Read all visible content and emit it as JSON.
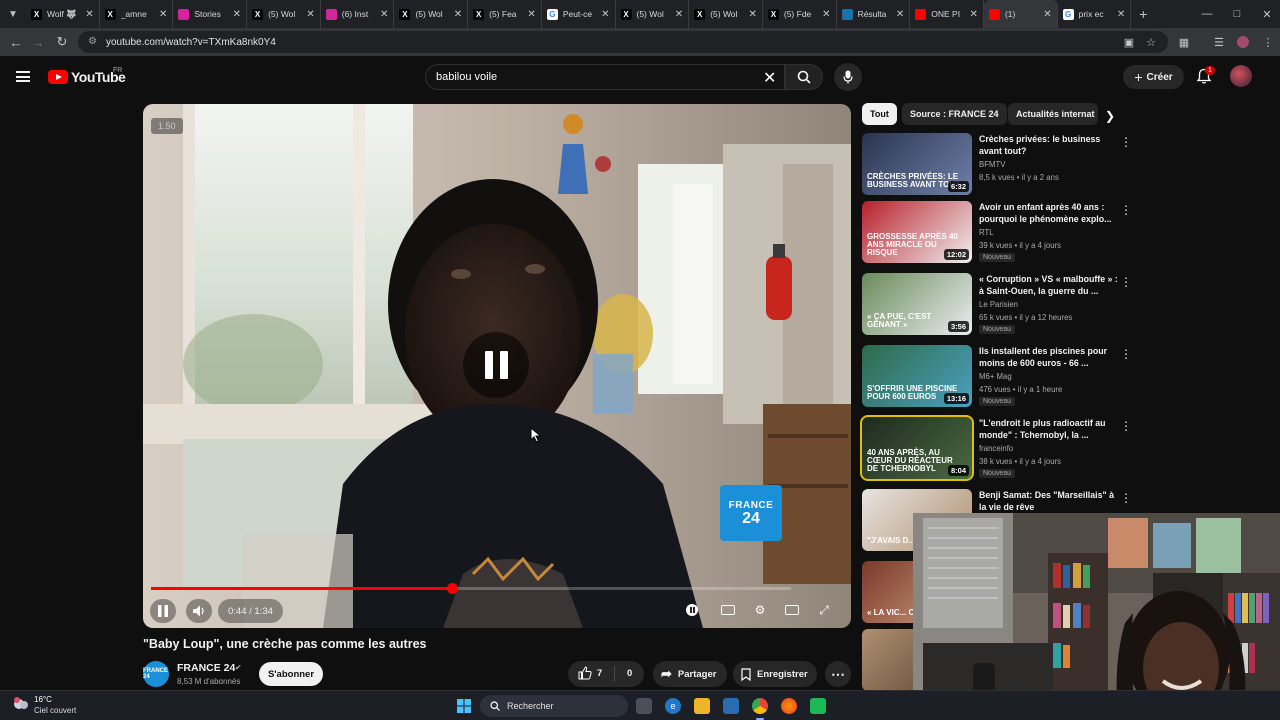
{
  "browser": {
    "tabs": [
      {
        "label": "Wolf 🐺",
        "icon": "x-logo-icon",
        "color": "#000000"
      },
      {
        "label": "_amne",
        "icon": "tiktok-icon",
        "color": "#000000"
      },
      {
        "label": "Stories",
        "icon": "instagram-icon",
        "color": "#d6249f"
      },
      {
        "label": "(5) Wol",
        "icon": "x-logo-icon",
        "color": "#000000"
      },
      {
        "label": "(6) Inst",
        "icon": "instagram-icon",
        "color": "#d6249f"
      },
      {
        "label": "(5) Wol",
        "icon": "x-logo-icon",
        "color": "#000000"
      },
      {
        "label": "(5) Fea",
        "icon": "x-logo-icon",
        "color": "#000000"
      },
      {
        "label": "Peut-ce",
        "icon": "page-icon",
        "color": "#ffffff"
      },
      {
        "label": "(5) Wol",
        "icon": "x-logo-icon",
        "color": "#000000"
      },
      {
        "label": "(5) Wol",
        "icon": "x-logo-icon",
        "color": "#000000"
      },
      {
        "label": "(5) Fde",
        "icon": "x-logo-icon",
        "color": "#000000"
      },
      {
        "label": "Résulta",
        "icon": "site-icon",
        "color": "#1a73a8"
      },
      {
        "label": "ONE PI",
        "icon": "youtube-icon",
        "color": "#ff0000"
      },
      {
        "label": "(1)",
        "icon": "youtube-icon",
        "color": "#ff0000",
        "active": true
      },
      {
        "label": "prix ec",
        "icon": "google-icon",
        "color": "#ffffff"
      }
    ],
    "url": "youtube.com/watch?v=TXmKa8nk0Y4"
  },
  "header": {
    "logo_text": "YouTube",
    "country_code": "FR",
    "search_value": "babilou  voile",
    "create_label": "Créer",
    "notification_count": "1"
  },
  "player": {
    "speed_indicator": "1.50",
    "time_display": "0:44 / 1:34",
    "progress": 0.47,
    "watermark_line1": "FRANCE",
    "watermark_line2": "24"
  },
  "video": {
    "title": "\"Baby Loup\", une crèche pas comme les autres",
    "channel_name": "FRANCE 24",
    "channel_logo_text": "FRANCE 24",
    "subscribers": "8,53 M d'abonnés",
    "subscribe_label": "S'abonner",
    "likes": "7",
    "dislikes": "0",
    "share_label": "Partager",
    "save_label": "Enregistrer"
  },
  "chips": [
    "Tout",
    "Source : FRANCE 24",
    "Actualités internat"
  ],
  "recommendations": [
    {
      "title": "Crèches privées: le business avant tout?",
      "channel": "BFMTV",
      "meta": "8,5 k vues • il y a 2 ans",
      "duration": "6:32",
      "thumb_text": "CRÈCHES PRIVÉES: LE BUSINESS AVANT TOUT",
      "badge": ""
    },
    {
      "title": "Avoir un enfant après 40 ans : pourquoi le phénomène explo...",
      "channel": "RTL",
      "meta": "39 k vues • il y a 4 jours",
      "duration": "12:02",
      "thumb_text": "GROSSESSE APRÈS 40 ANS MIRACLE OU RISQUE",
      "badge": "Nouveau"
    },
    {
      "title": "« Corruption » VS « malbouffe » : à Saint-Ouen, la guerre du ...",
      "channel": "Le Parisien",
      "meta": "65 k vues • il y a 12 heures",
      "duration": "3:56",
      "thumb_text": "« Ça pue, c'est gênant »",
      "badge": "Nouveau"
    },
    {
      "title": "Ils installent des piscines pour moins de 600 euros - 66 ...",
      "channel": "M6+ Mag",
      "meta": "476 vues • il y a 1 heure",
      "duration": "13:16",
      "thumb_text": "S'OFFRIR UNE PISCINE POUR 600 EUROS",
      "badge": "Nouveau"
    },
    {
      "title": "\"L'endroit le plus radioactif au monde\" : Tchernobyl, la ...",
      "channel": "franceinfo",
      "meta": "38 k vues • il y a 4 jours",
      "duration": "8:04",
      "thumb_text": "40 ans après, au cœur du réacteur de Tchernobyl",
      "badge": "Nouveau"
    },
    {
      "title": "Benji Samat: Des \"Marseillais\" à la vie de rêve",
      "channel": "",
      "meta": "",
      "duration": "",
      "thumb_text": "\"J'AVAIS D...",
      "badge": ""
    },
    {
      "title": "",
      "channel": "",
      "meta": "",
      "duration": "",
      "thumb_text": "« LA VIC... ODIEUSE",
      "badge": ""
    },
    {
      "title": "",
      "channel": "",
      "meta": "",
      "duration": "",
      "thumb_text": "",
      "badge": ""
    }
  ],
  "taskbar": {
    "weather_temp": "16°C",
    "weather_desc": "Ciel couvert",
    "search_label": "Rechercher"
  },
  "colors": {
    "youtube_red": "#ff0000",
    "background": "#0f0f0f",
    "france24_blue": "#1c8fd9"
  }
}
